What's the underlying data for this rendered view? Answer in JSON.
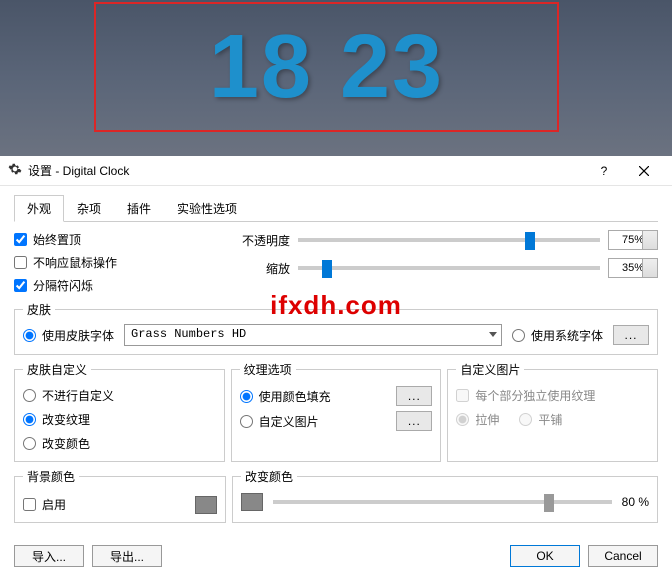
{
  "preview": {
    "time_text": "18 23"
  },
  "titlebar": {
    "title": "设置 - Digital Clock"
  },
  "tabs": [
    "外观",
    "杂项",
    "插件",
    "实验性选项"
  ],
  "general": {
    "stay_on_top": "始终置顶",
    "ignore_mouse": "不响应鼠标操作",
    "separator_flash": "分隔符闪烁",
    "opacity_label": "不透明度",
    "opacity_value": "75%",
    "zoom_label": "缩放",
    "zoom_value": "35%"
  },
  "watermark": "ifxdh.com",
  "skin": {
    "legend": "皮肤",
    "use_skin_font": "使用皮肤字体",
    "combo_value": "Grass Numbers HD",
    "use_sys_font": "使用系统字体"
  },
  "custom": {
    "skin_custom_legend": "皮肤自定义",
    "opt_none": "不进行自定义",
    "opt_texture": "改变纹理",
    "opt_color": "改变颜色",
    "texture_legend": "纹理选项",
    "use_color_fill": "使用颜色填充",
    "use_custom_image": "自定义图片",
    "custom_image_legend": "自定义图片",
    "per_part": "每个部分独立使用纹理",
    "stretch": "拉伸",
    "tile": "平铺"
  },
  "bg": {
    "legend": "背景颜色",
    "enable": "启用"
  },
  "color_change": {
    "legend": "改变颜色",
    "value": "80 %"
  },
  "footer": {
    "import": "导入...",
    "export": "导出...",
    "ok": "OK",
    "cancel": "Cancel"
  }
}
